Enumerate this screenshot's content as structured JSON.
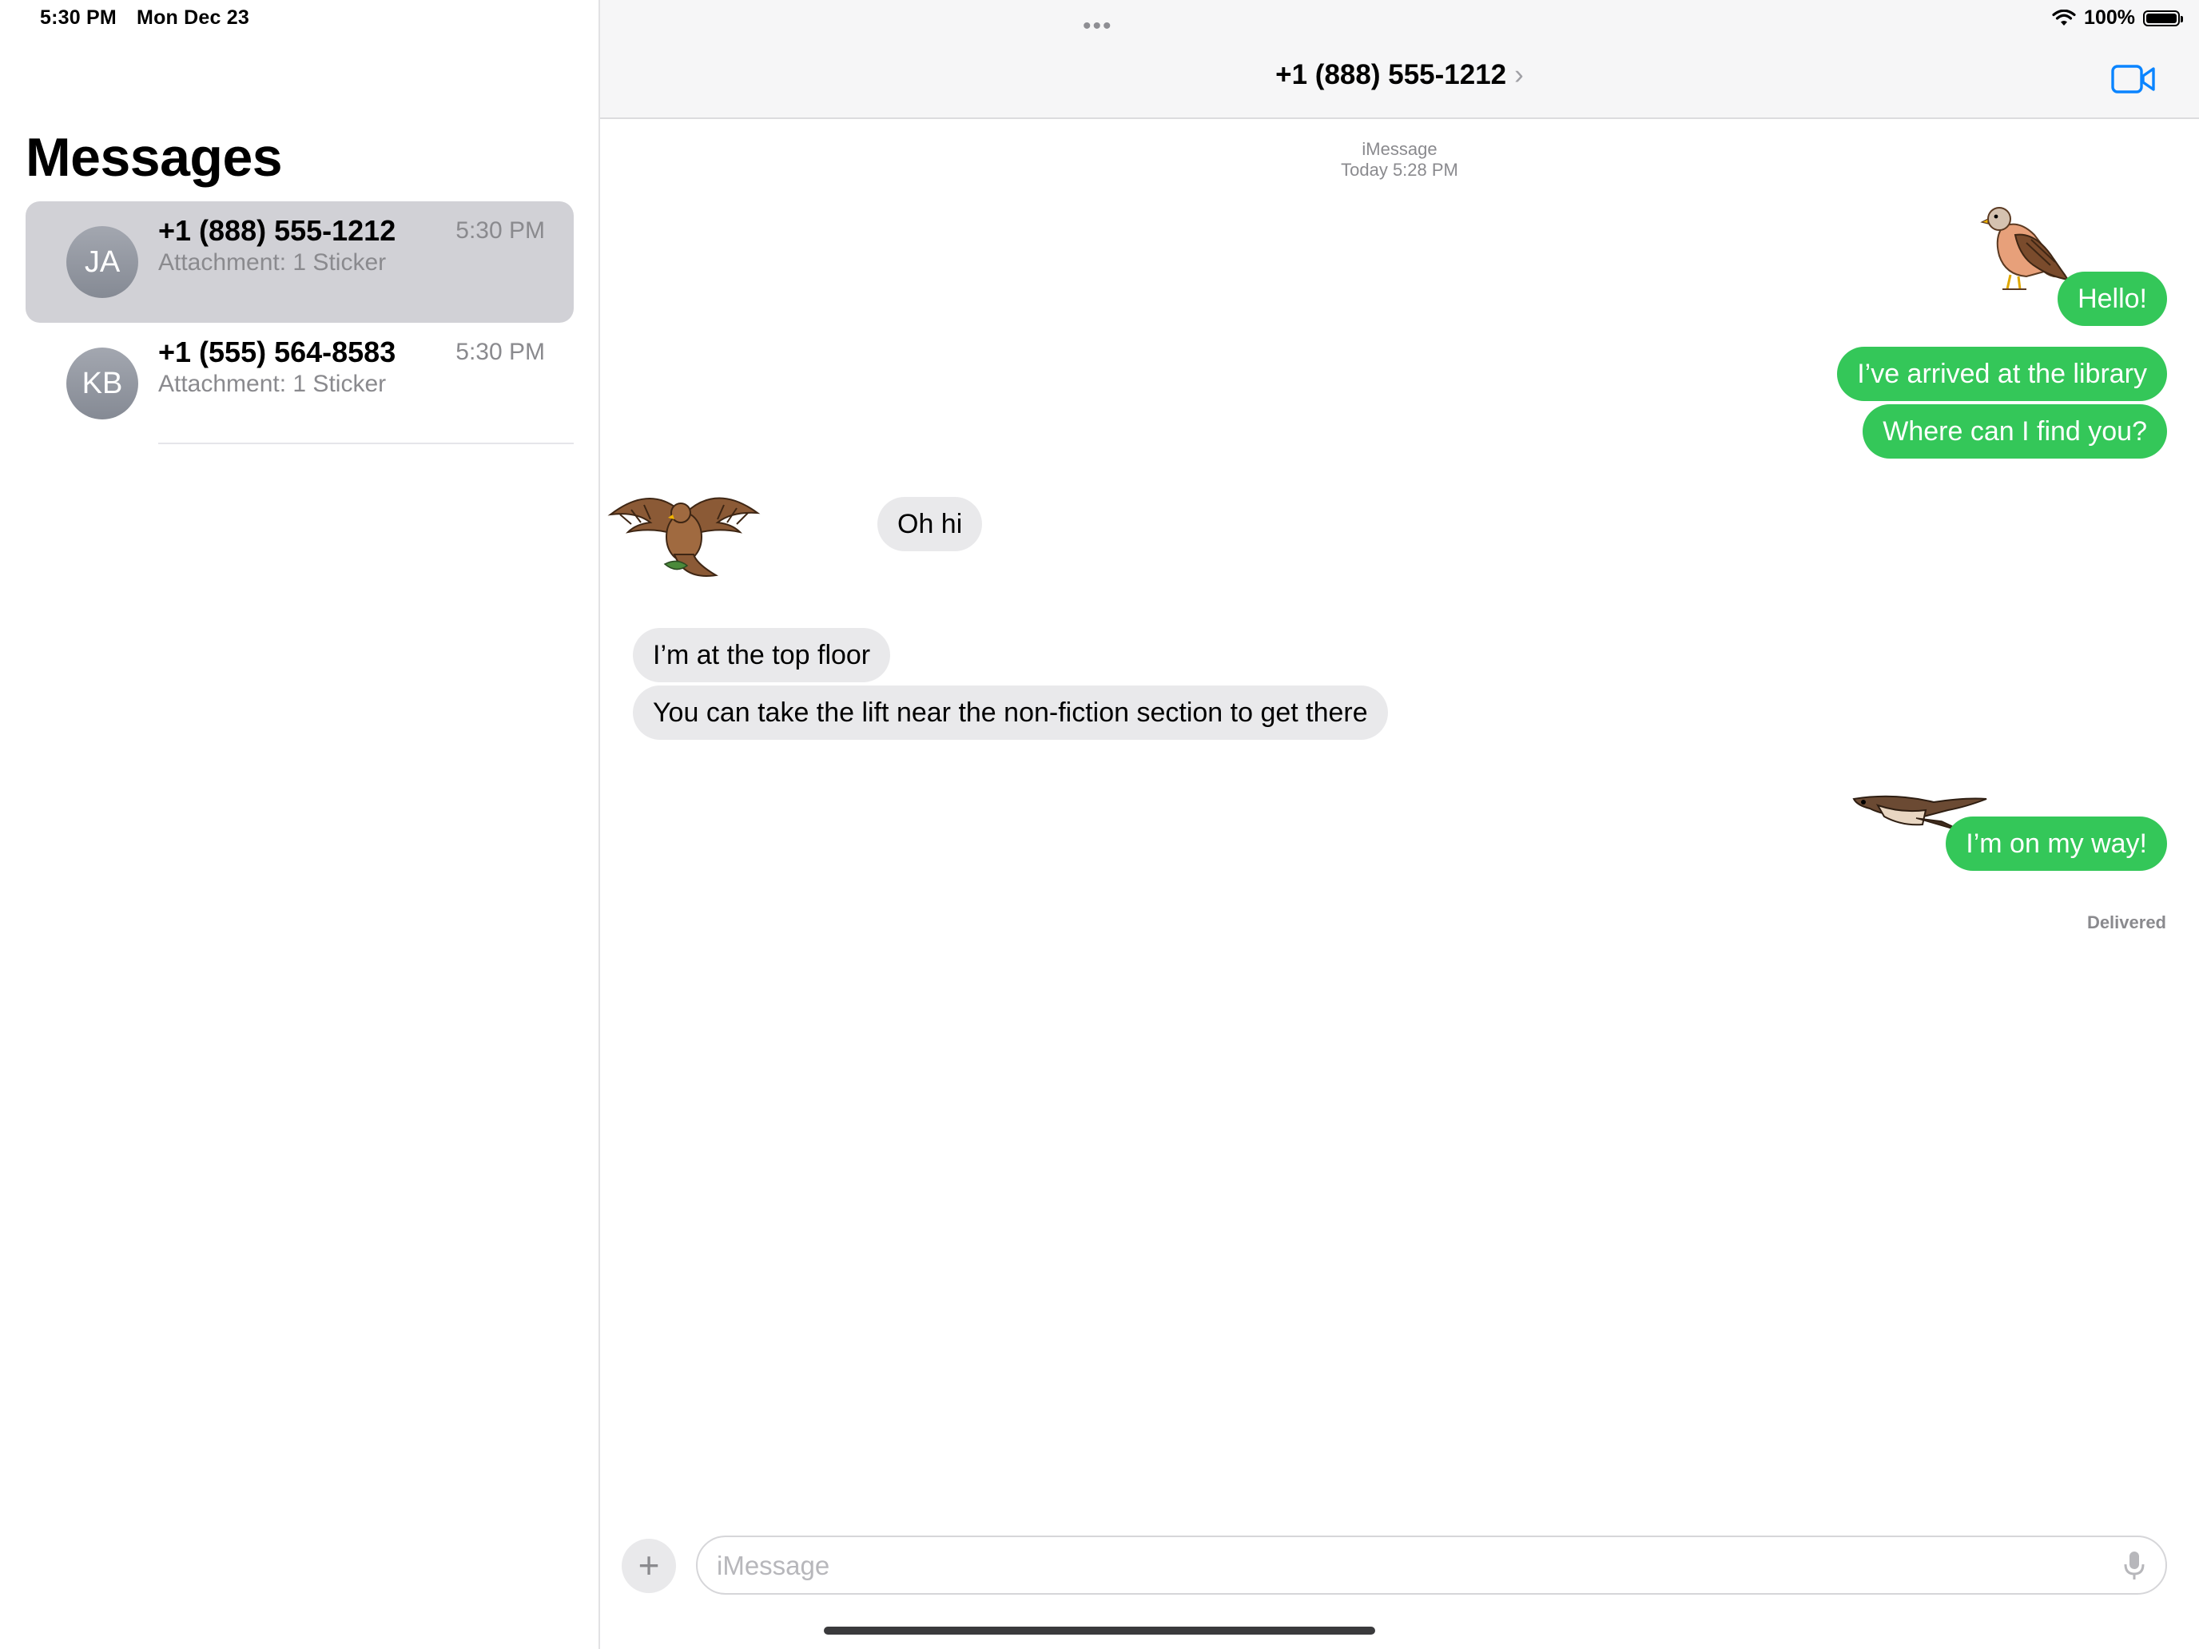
{
  "status_bar": {
    "time": "5:30 PM",
    "date": "Mon Dec 23",
    "battery": "100%",
    "multitask": "•••"
  },
  "sidebar": {
    "title": "Messages",
    "conversations": [
      {
        "initials": "JA",
        "name": "+1 (888) 555-1212",
        "time": "5:30 PM",
        "preview": "Attachment: 1 Sticker",
        "selected": true
      },
      {
        "initials": "KB",
        "name": "+1 (555) 564-8583",
        "time": "5:30 PM",
        "preview": "Attachment: 1 Sticker",
        "selected": false
      }
    ]
  },
  "chat": {
    "contact": "+1 (888) 555-1212",
    "chevron": "›",
    "service": "iMessage",
    "timestamp": "Today 5:28 PM",
    "messages": [
      {
        "direction": "out",
        "text": "Hello!"
      },
      {
        "direction": "out",
        "text": "I’ve arrived at the library"
      },
      {
        "direction": "out",
        "text": "Where can I find you?"
      },
      {
        "direction": "in",
        "text": "Oh hi"
      },
      {
        "direction": "in",
        "text": "I’m at the top floor"
      },
      {
        "direction": "in",
        "text": "You can take the lift near the non-fiction section to get there"
      },
      {
        "direction": "out",
        "text": "I’m on my way!"
      }
    ],
    "stickers": [
      "perched-bird-sticker",
      "hawk-spread-wings-sticker",
      "flying-bird-sticker"
    ],
    "delivered": "Delivered"
  },
  "composer": {
    "placeholder": "iMessage",
    "plus": "+"
  },
  "colors": {
    "outgoing_bubble": "#34c759",
    "incoming_bubble": "#e9e9eb",
    "accent": "#0a84ff",
    "selected_row": "#d1d1d6"
  }
}
